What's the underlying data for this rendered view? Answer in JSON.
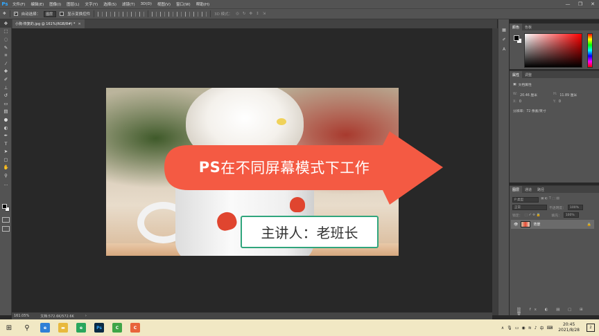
{
  "app": {
    "logo": "Ps"
  },
  "menu": [
    "文件(F)",
    "编辑(E)",
    "图像(I)",
    "图层(L)",
    "文字(Y)",
    "选择(S)",
    "滤镜(T)",
    "3D(D)",
    "视图(V)",
    "窗口(W)",
    "帮助(H)"
  ],
  "window_controls": {
    "minimize": "—",
    "restore": "❐",
    "close": "✕"
  },
  "options": {
    "auto_select_label": "自动选择：",
    "auto_select_value": "图层",
    "show_transform_label": "显示变换控件",
    "mode_3d_label": "3D 模式："
  },
  "document": {
    "tab_title": "小狗-恢复的.jpg @ 161%(RGB/8#) *",
    "zoom": "161.05%",
    "doc_size": "文档:572.6K/572.6K"
  },
  "artwork": {
    "title_bold": "PS",
    "title_rest": "在不同屏幕模式下工作",
    "presenter": "主讲人：老班长",
    "colors": {
      "arrow": "#f45a43",
      "presenter_border": "#2fa57c"
    }
  },
  "panels": {
    "color_tabs": [
      "颜色",
      "色板"
    ],
    "props_tabs": [
      "属性",
      "调整"
    ],
    "props_section": "文档属性",
    "width_label": "W:",
    "width_value": "20.46 厘米",
    "height_label": "H:",
    "height_value": "11.89 厘米",
    "x_label": "X:",
    "x_value": "0",
    "y_label": "Y:",
    "y_value": "0",
    "resolution": "分辨率：72 像素/英寸",
    "layers_tabs": [
      "图层",
      "通道",
      "路径"
    ],
    "layer_kind": "P 类型",
    "blend_mode": "正常",
    "opacity_label": "不透明度：",
    "opacity_value": "100%",
    "fill_label": "填充：",
    "fill_value": "100%",
    "lock_label": "锁定：",
    "layer_name": "背景"
  },
  "taskbar": {
    "time": "20:45",
    "date": "2021/8/28",
    "ime": "中",
    "notification_count": "2"
  }
}
